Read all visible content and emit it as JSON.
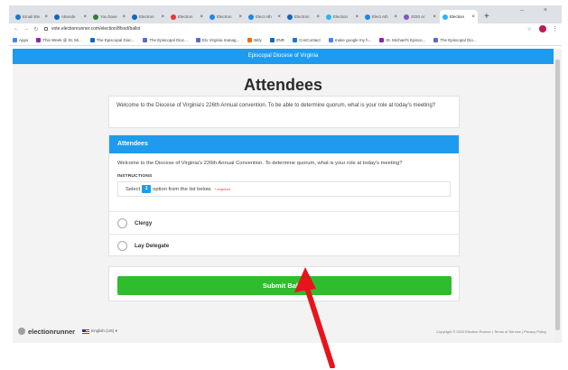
{
  "browser": {
    "tabs": [
      {
        "label": "Email Ele",
        "color": "#1976d2"
      },
      {
        "label": "Attende",
        "color": "#1565c0"
      },
      {
        "label": "You have",
        "color": "#2e7d32"
      },
      {
        "label": "Electron",
        "color": "#1565c0"
      },
      {
        "label": "Electron",
        "color": "#e53935"
      },
      {
        "label": "Electron",
        "color": "#1e88e5"
      },
      {
        "label": "Elect Ath",
        "color": "#1e88e5"
      },
      {
        "label": "Electron",
        "color": "#1565c0"
      },
      {
        "label": "Election",
        "color": "#29b6f6"
      },
      {
        "label": "Elect Ath",
        "color": "#1e88e5"
      },
      {
        "label": "2020 Ar",
        "color": "#7e57c2"
      },
      {
        "label": "Election",
        "color": "#29b6f6"
      }
    ],
    "new_tab": "+",
    "window_controls": "– ×",
    "url": "vote.electionrunner.com/election/8fsxd/ballot",
    "bookmarks": [
      {
        "label": "Apps",
        "color": "#4285f4"
      },
      {
        "label": "This Week @ St. Mi...",
        "color": "#8e24aa"
      },
      {
        "label": "The Episcopal Dioc...",
        "color": "#1565c0"
      },
      {
        "label": "The Episcopal Dioc...",
        "color": "#5c6bc0"
      },
      {
        "label": "Elo Virginia manag...",
        "color": "#5c6bc0"
      },
      {
        "label": "Bitly",
        "color": "#ef6c00"
      },
      {
        "label": "ZNR",
        "color": "#1565c0"
      },
      {
        "label": "ConContact",
        "color": "#1976d2"
      },
      {
        "label": "make google my h...",
        "color": "#4285f4"
      },
      {
        "label": "St. Michael's Episco...",
        "color": "#8e24aa"
      },
      {
        "label": "The Episcopal Dio...",
        "color": "#5c6bc0"
      }
    ]
  },
  "page": {
    "banner": "Episcopal Diocese of Virginia",
    "title": "Attendees",
    "welcome": "Welcome to the Diocese of Virginia's 226th Annual convention. To be able to determine quorum, what is your role at today's meeting?",
    "section_title": "Attendees",
    "section_welcome": "Welcome to the Diocese of Virginia's 226th Annual Convention. To determine quorum, what is your role at today's meeting?",
    "instructions_label": "INSTRUCTIONS",
    "instr_pre": "Select",
    "instr_count": "1",
    "instr_post": "option from the list below.",
    "required": "* required",
    "options": [
      "Clergy",
      "Lay Delegate"
    ],
    "submit_label": "Submit Ballot",
    "footer_brand": "electionrunner",
    "footer_lang": "English (US) ▾",
    "footer_copyright": "Copyright © 2020 Election Runner | Terms of Service | Privacy Policy"
  },
  "colors": {
    "accent": "#1e9bef",
    "submit": "#2dbd2d",
    "annotation_arrow": "#e8141b"
  }
}
